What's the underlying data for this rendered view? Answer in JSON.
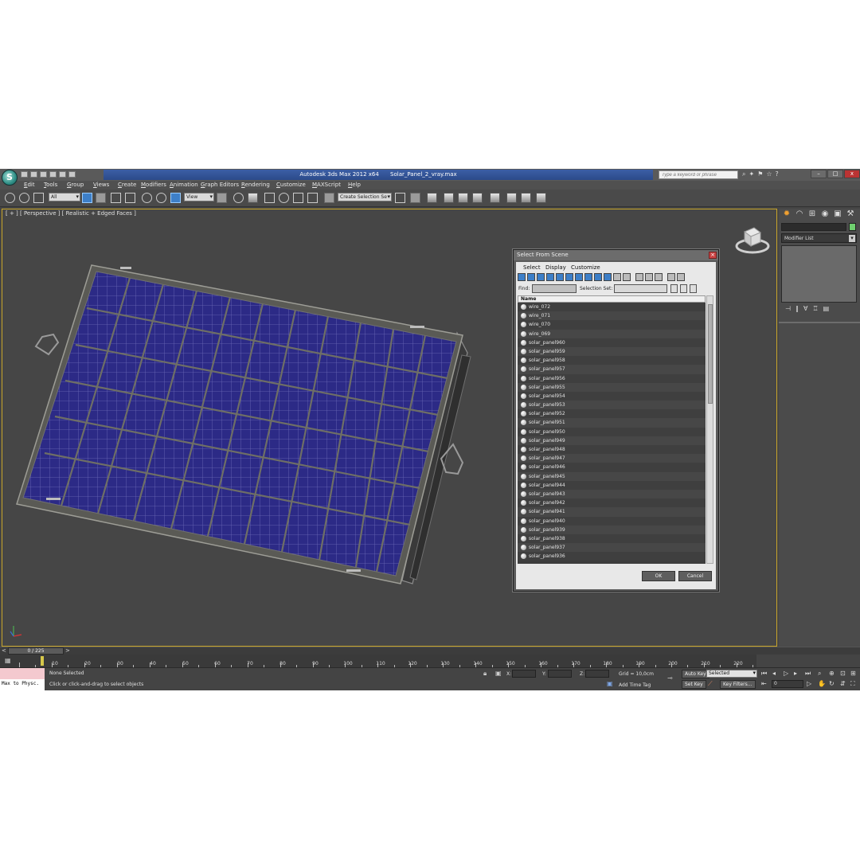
{
  "window": {
    "app_name": "Autodesk 3ds Max  2012 x64",
    "file_name": "Solar_Panel_2_vray.max",
    "search_placeholder": "Type a keyword or phrase",
    "logo_glyph": "S",
    "min": "–",
    "max": "□",
    "close": "x"
  },
  "menu": [
    "Edit",
    "Tools",
    "Group",
    "Views",
    "Create",
    "Modifiers",
    "Animation",
    "Graph Editors",
    "Rendering",
    "Customize",
    "MAXScript",
    "Help"
  ],
  "toolbar": {
    "selection_filter": "All",
    "ref_coord": "View",
    "named_selection": "Create Selection Se"
  },
  "viewport": {
    "label": "[ + ] [ Perspective ] [ Realistic + Edged Faces ]"
  },
  "command_panel": {
    "modifier_list": "Modifier List"
  },
  "dialog": {
    "title": "Select From Scene",
    "menu": [
      "Select",
      "Display",
      "Customize"
    ],
    "find_label": "Find:",
    "selection_set_label": "Selection Set:",
    "column_header": "Name",
    "rows": [
      "wire_072",
      "wire_071",
      "wire_070",
      "wire_069",
      "solar_panel960",
      "solar_panel959",
      "solar_panel958",
      "solar_panel957",
      "solar_panel956",
      "solar_panel955",
      "solar_panel954",
      "solar_panel953",
      "solar_panel952",
      "solar_panel951",
      "solar_panel950",
      "solar_panel949",
      "solar_panel948",
      "solar_panel947",
      "solar_panel946",
      "solar_panel945",
      "solar_panel944",
      "solar_panel943",
      "solar_panel942",
      "solar_panel941",
      "solar_panel940",
      "solar_panel939",
      "solar_panel938",
      "solar_panel937",
      "solar_panel936"
    ],
    "ok_label": "OK",
    "cancel_label": "Cancel"
  },
  "timeline": {
    "frame_display": "0 / 225",
    "ticks": [
      "10",
      "20",
      "30",
      "40",
      "50",
      "60",
      "70",
      "80",
      "90",
      "100",
      "110",
      "120",
      "130",
      "140",
      "150",
      "160",
      "170",
      "180",
      "190",
      "200",
      "210",
      "220"
    ]
  },
  "status": {
    "script_listener": "Max to Physc.",
    "selection": "None Selected",
    "prompt": "Click or click-and-drag to select objects",
    "x_label": "X:",
    "y_label": "Y:",
    "z_label": "Z:",
    "grid": "Grid = 10,0cm",
    "add_time_tag": "Add Time Tag",
    "auto_key": "Auto Key",
    "set_key": "Set Key",
    "key_mode": "Selected",
    "key_filters": "Key Filters...",
    "current_frame": "0"
  }
}
